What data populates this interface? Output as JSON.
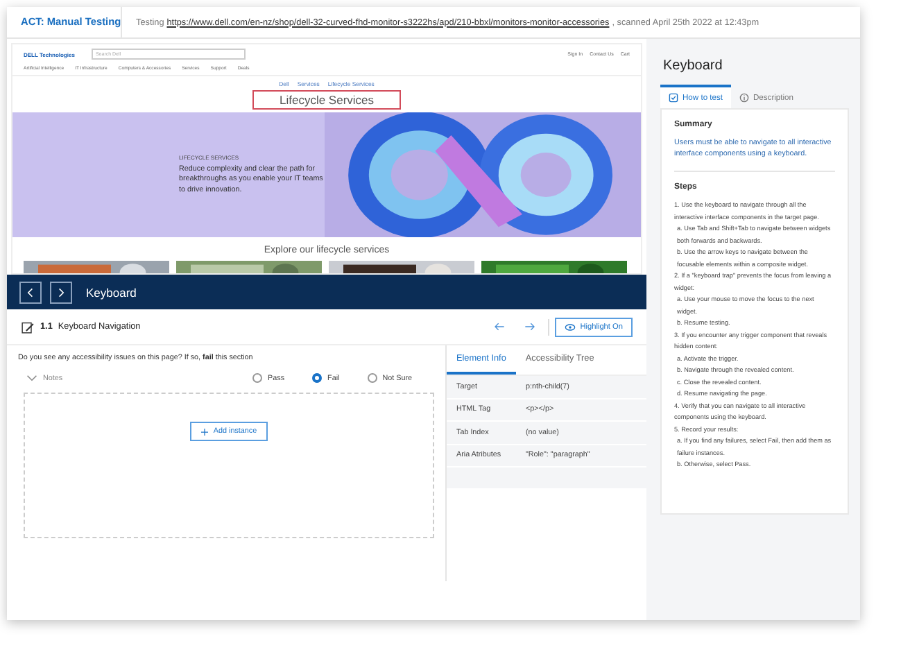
{
  "top_bar": {
    "app_title": "ACT: Manual Testing",
    "testing_label": "Testing",
    "url": "https://www.dell.com/en-nz/shop/dell-32-curved-fhd-monitor-s3222hs/apd/210-bbxl/monitors-monitor-accessories",
    "scanned": ", scanned April 25th 2022 at 12:43pm"
  },
  "site": {
    "logo": "DELL Technologies",
    "search_placeholder": "Search Dell",
    "account_links": [
      "Sign In",
      "Contact Us",
      "Cart"
    ],
    "nav": [
      "Artificial Intelligence",
      "IT Infrastructure",
      "Computers & Accessories",
      "Services",
      "Support",
      "Deals"
    ],
    "breadcrumb": [
      "Dell",
      "Services",
      "Lifecycle Services"
    ],
    "page_title": "Lifecycle Services",
    "hero_eyebrow": "LIFECYCLE SERVICES",
    "hero_text": "Reduce complexity and clear the path for breakthroughs as you enable your IT teams to drive innovation.",
    "explore_heading": "Explore our lifecycle services",
    "photos": [
      {
        "kind": "picture"
      },
      {
        "kind": "picture"
      },
      {
        "kind": "picture"
      },
      {
        "kind": "picture"
      }
    ]
  },
  "test_bar": {
    "title": "Keyboard"
  },
  "section": {
    "number": "1.1",
    "title": "Keyboard Navigation",
    "highlight_button": "Highlight On"
  },
  "question": "Do you see any accessibility issues on this page? If so, **fail** this section",
  "notes_label": "Notes",
  "results": [
    {
      "label": "Pass",
      "selected": false
    },
    {
      "label": "Fail",
      "selected": true
    },
    {
      "label": "Not Sure",
      "selected": false
    }
  ],
  "add_instance": "Add instance",
  "info_tabs": [
    {
      "label": "Element Info",
      "selected": true
    },
    {
      "label": "Accessibility Tree",
      "selected": false
    }
  ],
  "element_info": [
    {
      "label": "Target",
      "value": "p:nth-child(7)"
    },
    {
      "label": "HTML Tag",
      "value": "<p></p>"
    },
    {
      "label": "Tab Index",
      "value": "(no value)"
    },
    {
      "label": "Aria Atributes",
      "value": "\"Role\": \"paragraph\""
    }
  ],
  "guide": {
    "title": "Keyboard",
    "tabs": [
      {
        "label": "How to test",
        "selected": true
      },
      {
        "label": "Description",
        "selected": false
      }
    ],
    "summary_heading": "Summary",
    "summary": "Users must be able to navigate to all interactive interface components using a keyboard.",
    "steps_heading": "Steps",
    "steps": [
      {
        "kind": "step",
        "text": "1. Use the keyboard to navigate through all the interactive interface components in the target page."
      },
      {
        "kind": "sub",
        "text": "a. Use Tab and Shift+Tab to navigate between widgets both forwards and backwards."
      },
      {
        "kind": "sub",
        "text": "b. Use the arrow keys to navigate between the focusable elements within a composite widget."
      },
      {
        "kind": "step",
        "text": "2. If a \"keyboard trap\" prevents the focus from leaving a widget:"
      },
      {
        "kind": "sub",
        "text": "a. Use your mouse to move the focus to the next widget."
      },
      {
        "kind": "sub",
        "text": "b. Resume testing."
      },
      {
        "kind": "step",
        "text": "3. If you encounter any trigger component that reveals hidden content:"
      },
      {
        "kind": "sub",
        "text": "a. Activate the trigger."
      },
      {
        "kind": "sub",
        "text": "b. Navigate through the revealed content."
      },
      {
        "kind": "sub",
        "text": "c. Close the revealed content."
      },
      {
        "kind": "sub",
        "text": "d. Resume navigating the page."
      },
      {
        "kind": "step",
        "text": "4. Verify that you can navigate to all interactive components using the keyboard."
      },
      {
        "kind": "step",
        "text": "5. Record your results:"
      },
      {
        "kind": "sub",
        "text": "a. If you find any failures, select Fail, then add them as failure instances."
      },
      {
        "kind": "sub",
        "text": "b. Otherwise, select Pass."
      }
    ]
  }
}
